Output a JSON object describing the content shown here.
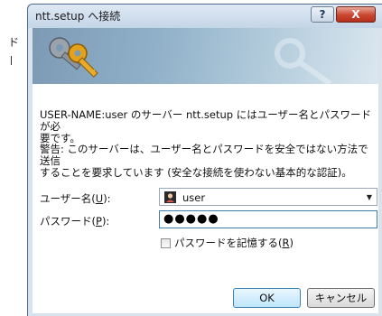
{
  "margin": {
    "char": "ド"
  },
  "window": {
    "title": "ntt.setup へ接続",
    "help_glyph": "?",
    "close_glyph": "X"
  },
  "message": {
    "line1a": "USER-NAME:user のサーバー ntt.setup にはユーザー名とパスワードが必",
    "line1b": "要です。",
    "line2a": "警告: このサーバーは、ユーザー名とパスワードを安全ではない方法で送信",
    "line2b": "することを要求しています (安全な接続を使わない基本的な認証)。"
  },
  "form": {
    "username_label_text": "ユーザー名(",
    "username_label_key": "U",
    "username_label_tail": "):",
    "username_value": "user",
    "password_label_text": "パスワード(",
    "password_label_key": "P",
    "password_label_tail": "):",
    "password_value": "●●●●●",
    "remember_text": "パスワードを記憶する(",
    "remember_key": "R",
    "remember_tail": ")",
    "remember_checked": false
  },
  "buttons": {
    "ok_label": "OK",
    "cancel_label": "キャンセル"
  },
  "icons": {
    "banner": "keys-icon",
    "user": "user-icon",
    "dropdown": "chevron-down-icon",
    "help": "help-icon",
    "close": "close-icon"
  }
}
